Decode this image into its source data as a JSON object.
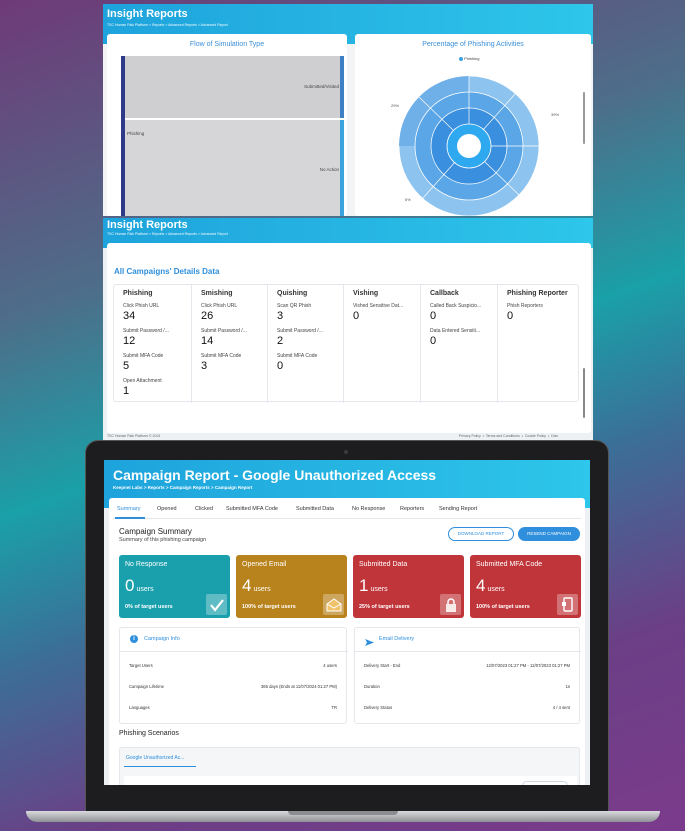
{
  "panel1": {
    "title": "Insight Reports",
    "breadcrumb": "TSC Human Risk Platform > Reports > Advanced Reports > Advanced Report"
  },
  "flow": {
    "title": "Flow of Simulation Type",
    "nodes": {
      "left": "Phishing",
      "right_top": "Submitted/Visited",
      "right_bottom": "No Action"
    }
  },
  "sunburst": {
    "title": "Percentage of Phishing Activities",
    "legend": "Phishing",
    "pct_left": "29%",
    "pct_right": "39%",
    "pct_bottom": "6%"
  },
  "panel2": {
    "title": "Insight Reports",
    "breadcrumb": "TSC Human Risk Platform > Reports > Advanced Reports > Advanced Report"
  },
  "campaigns": {
    "title": "All Campaigns' Details Data",
    "columns": [
      {
        "name": "Phishing",
        "items": [
          {
            "label": "Click Phish URL",
            "value": "34"
          },
          {
            "label": "Submit Password /...",
            "value": "12"
          },
          {
            "label": "Submit MFA Code",
            "value": "5"
          },
          {
            "label": "Open Attachment",
            "value": "1"
          }
        ]
      },
      {
        "name": "Smishing",
        "items": [
          {
            "label": "Click Phish URL",
            "value": "26"
          },
          {
            "label": "Submit Password /...",
            "value": "14"
          },
          {
            "label": "Submit MFA Code",
            "value": "3"
          }
        ]
      },
      {
        "name": "Quishing",
        "items": [
          {
            "label": "Scan QR Phish",
            "value": "3"
          },
          {
            "label": "Submit Password /...",
            "value": "2"
          },
          {
            "label": "Submit MFA Code",
            "value": "0"
          }
        ]
      },
      {
        "name": "Vishing",
        "items": [
          {
            "label": "Vished Sensitive Dat...",
            "value": "0"
          }
        ]
      },
      {
        "name": "Callback",
        "items": [
          {
            "label": "Called Back Suspicio...",
            "value": "0"
          },
          {
            "label": "Data Entered Sensiti...",
            "value": "0"
          }
        ]
      },
      {
        "name": "Phishing Reporter",
        "items": [
          {
            "label": "Phish Reporters",
            "value": "0"
          }
        ]
      }
    ]
  },
  "footer": {
    "left": "TSC Human Risk Platform © 2024",
    "links": [
      "Privacy Policy",
      "Terms and Conditions",
      "Cookie Policy",
      "Dcis"
    ]
  },
  "report": {
    "title": "Campaign Report - Google Unauthorized Access",
    "breadcrumb": "Keepnet Labs > Reports > Campaign Reports > Campaign Report",
    "tabs": [
      "Summary",
      "Opened",
      "Clicked",
      "Submitted MFA Code",
      "Submitted Data",
      "No Response",
      "Reporters",
      "Sending Report"
    ],
    "summary_title": "Campaign Summary",
    "summary_sub": "Summary of this phishing campaign",
    "download_btn": "DOWNLOAD REPORT",
    "resend_btn": "RESEND CAMPAIGN",
    "stats": [
      {
        "title": "No Response",
        "value": "0",
        "unit": "users",
        "pct": "0% of target users",
        "color": "#1aa0ad"
      },
      {
        "title": "Opened Email",
        "value": "4",
        "unit": "users",
        "pct": "100% of target users",
        "color": "#b8821c"
      },
      {
        "title": "Submitted Data",
        "value": "1",
        "unit": "users",
        "pct": "25% of target users",
        "color": "#c0353a"
      },
      {
        "title": "Submitted MFA Code",
        "value": "4",
        "unit": "users",
        "pct": "100% of target users",
        "color": "#c0353a"
      }
    ],
    "info": {
      "title": "Campaign Info",
      "rows": [
        {
          "label": "Target Users",
          "value": "4 users"
        },
        {
          "label": "Campaign Lifetime",
          "value": "365 days (Ends at 11/07/2024 01:27 PM)"
        },
        {
          "label": "Languages",
          "value": "TR"
        }
      ]
    },
    "delivery": {
      "title": "Email Delivery",
      "rows": [
        {
          "label": "Delivery Start - End",
          "value": "12/07/2023 01:27 PM - 12/07/2023 01:27 PM"
        },
        {
          "label": "Duration",
          "value": "1s"
        },
        {
          "label": "Delivery Status",
          "value": "4 / 4 sent"
        }
      ]
    },
    "scenarios_title": "Phishing Scenarios",
    "scenario_tab": "Google Unauthorized Ac..."
  }
}
